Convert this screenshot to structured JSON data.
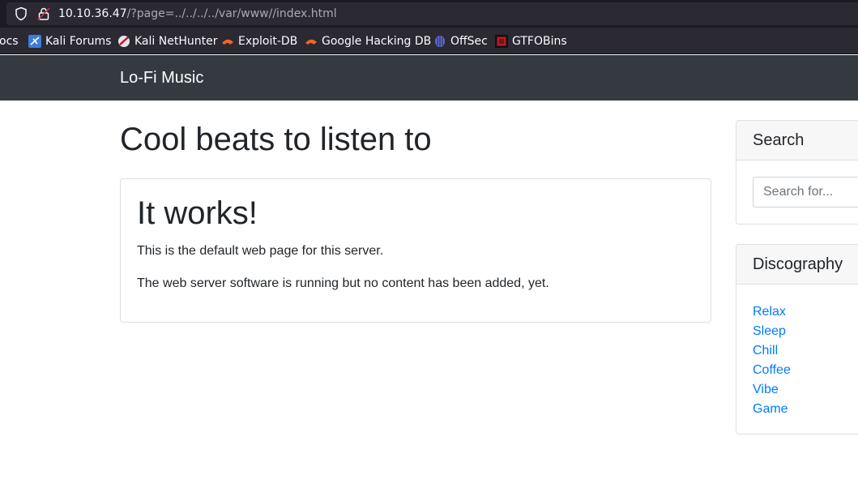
{
  "browser": {
    "url_host": "10.10.36.47",
    "url_path": "/?page=../../../../var/www//index.html",
    "bookmarks": [
      {
        "label": "ocs",
        "icon": "docs-icon"
      },
      {
        "label": "Kali Forums",
        "icon": "kali-forums-icon"
      },
      {
        "label": "Kali NetHunter",
        "icon": "kali-nethunter-icon"
      },
      {
        "label": "Exploit-DB",
        "icon": "exploit-db-icon"
      },
      {
        "label": "Google Hacking DB",
        "icon": "ghdb-icon"
      },
      {
        "label": "OffSec",
        "icon": "offsec-icon"
      },
      {
        "label": "GTFOBins",
        "icon": "gtfobins-icon"
      }
    ]
  },
  "navbar": {
    "brand": "Lo-Fi Music"
  },
  "main": {
    "title": "Cool beats to listen to",
    "card": {
      "heading": "It works!",
      "paragraphs": [
        "This is the default web page for this server.",
        "The web server software is running but no content has been added, yet."
      ]
    }
  },
  "sidebar": {
    "search": {
      "heading": "Search",
      "placeholder": "Search for..."
    },
    "discography": {
      "heading": "Discography",
      "items": [
        "Relax",
        "Sleep",
        "Chill",
        "Coffee",
        "Vibe",
        "Game"
      ]
    }
  },
  "colors": {
    "navbar_bg": "#343a40",
    "link": "#007bff",
    "chrome_bg": "#2b2a33"
  }
}
